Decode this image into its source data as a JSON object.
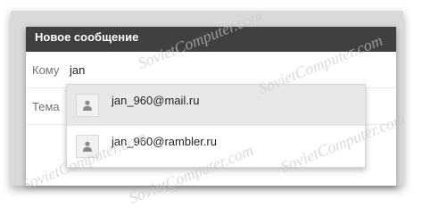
{
  "compose": {
    "title": "Новое сообщение",
    "to_label": "Кому",
    "to_value": "jan",
    "subject_label": "Тема"
  },
  "suggestions": [
    {
      "email": "jan_960@mail.ru",
      "icon": "person-icon",
      "highlighted": true
    },
    {
      "email": "jan_960@rambler.ru",
      "icon": "person-icon",
      "highlighted": false
    }
  ],
  "watermark": "SovietComputer.com"
}
